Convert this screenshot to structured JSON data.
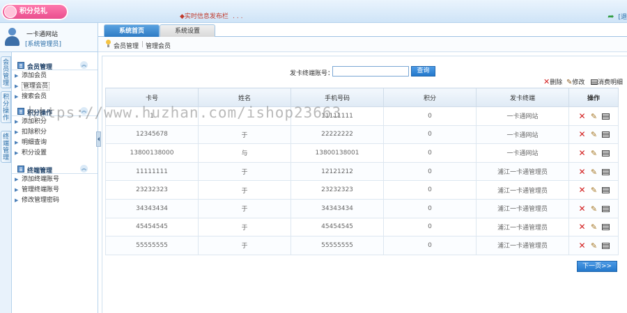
{
  "header": {
    "logo_text": "积分兑礼",
    "marquee": "实时信息发布栏",
    "marquee_dots": "...",
    "exit_label": "[退"
  },
  "user": {
    "site": "一卡通网站",
    "role": "[系统管理员]"
  },
  "tabs": [
    {
      "label": "系统首页"
    },
    {
      "label": "系统设置"
    }
  ],
  "breadcrumb": {
    "first": "会员管理",
    "separator": "|",
    "second": "管理会员"
  },
  "vtabs": [
    {
      "label": "会员管理"
    },
    {
      "label": "积分操作"
    },
    {
      "label": "终端管理"
    }
  ],
  "sidebar": {
    "groups": [
      {
        "title": "会员管理",
        "items": [
          "添加会员",
          "管理会员",
          "搜索会员"
        ]
      },
      {
        "title": "积分操作",
        "items": [
          "添加积分",
          "扣除积分",
          "明细查询",
          "积分设置"
        ]
      },
      {
        "title": "终端管理",
        "items": [
          "添加终端账号",
          "管理终端账号",
          "修改管理密码"
        ]
      }
    ]
  },
  "search": {
    "label": "发卡终端账号：",
    "value": "",
    "button": "查询"
  },
  "toolbar": {
    "delete": "删除",
    "edit": "修改",
    "detail": "消费明细"
  },
  "table": {
    "headers": [
      "卡号",
      "姓名",
      "手机号码",
      "积分",
      "发卡终端",
      "操作"
    ],
    "rows": [
      [
        "1",
        "",
        "11111111",
        "0",
        "一卡通网站"
      ],
      [
        "12345678",
        "于",
        "22222222",
        "0",
        "一卡通网站"
      ],
      [
        "13800138000",
        "与",
        "13800138001",
        "0",
        "一卡通网站"
      ],
      [
        "11111111",
        "于",
        "12121212",
        "0",
        "浦江一卡通管理员"
      ],
      [
        "23232323",
        "于",
        "23232323",
        "0",
        "浦江一卡通管理员"
      ],
      [
        "34343434",
        "于",
        "34343434",
        "0",
        "浦江一卡通管理员"
      ],
      [
        "45454545",
        "于",
        "45454545",
        "0",
        "浦江一卡通管理员"
      ],
      [
        "55555555",
        "于",
        "55555555",
        "0",
        "浦江一卡通管理员"
      ]
    ]
  },
  "pagination": {
    "next": "下一页>>"
  },
  "watermark": "https://www.huzhan.com/ishop23663"
}
